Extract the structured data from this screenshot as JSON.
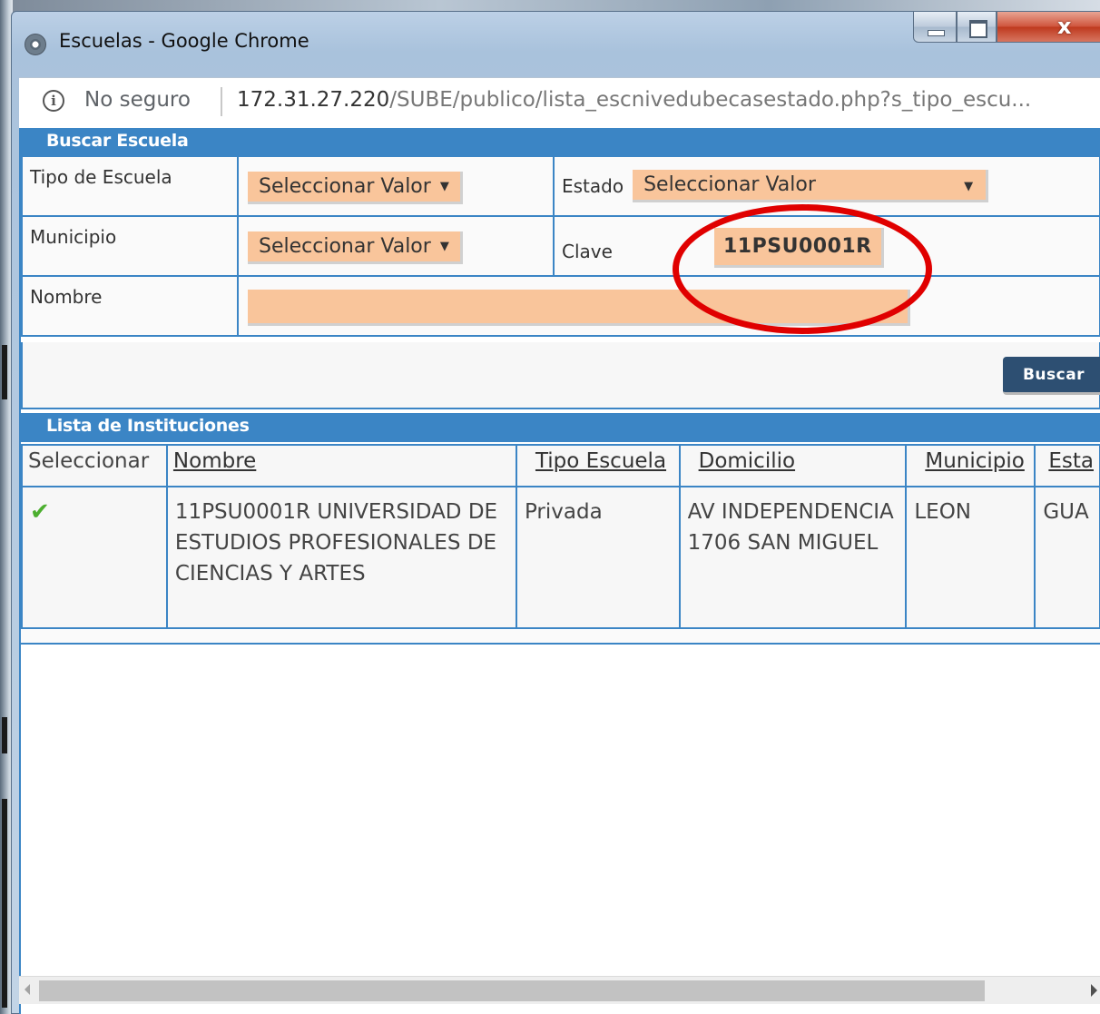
{
  "window": {
    "title": "Escuelas - Google Chrome"
  },
  "addressbar": {
    "security_label": "No seguro",
    "url_host": "172.31.27.220",
    "url_path": "/SUBE/publico/lista_escnivedubecasestado.php?s_tipo_escu..."
  },
  "search": {
    "header": "Buscar Escuela",
    "tipo_label": "Tipo de Escuela",
    "tipo_value": "Seleccionar Valor",
    "estado_label": "Estado",
    "estado_value": "Seleccionar Valor",
    "municipio_label": "Municipio",
    "municipio_value": "Seleccionar Valor",
    "clave_label": "Clave",
    "clave_value": "11PSU0001R",
    "nombre_label": "Nombre",
    "nombre_value": "",
    "buscar_button": "Buscar"
  },
  "results": {
    "header": "Lista de Instituciones",
    "columns": [
      "Seleccionar",
      "Nombre",
      "Tipo Escuela",
      "Domicilio",
      "Municipio",
      "Esta"
    ],
    "rows": [
      {
        "nombre": "11PSU0001R UNIVERSIDAD DE ESTUDIOS PROFESIONALES DE CIENCIAS Y ARTES",
        "tipo": "Privada",
        "domicilio": "AV INDEPENDENCIA 1706 SAN MIGUEL",
        "municipio": "LEON",
        "estado": "GUA"
      }
    ]
  },
  "colors": {
    "header_blue": "#3b85c5",
    "field_orange": "#f9c59b",
    "button_navy": "#2d4f72",
    "annotation_red": "#e00000"
  },
  "icons": {
    "select": "checkmark-icon",
    "info": "info-icon",
    "browser": "chrome-icon"
  }
}
